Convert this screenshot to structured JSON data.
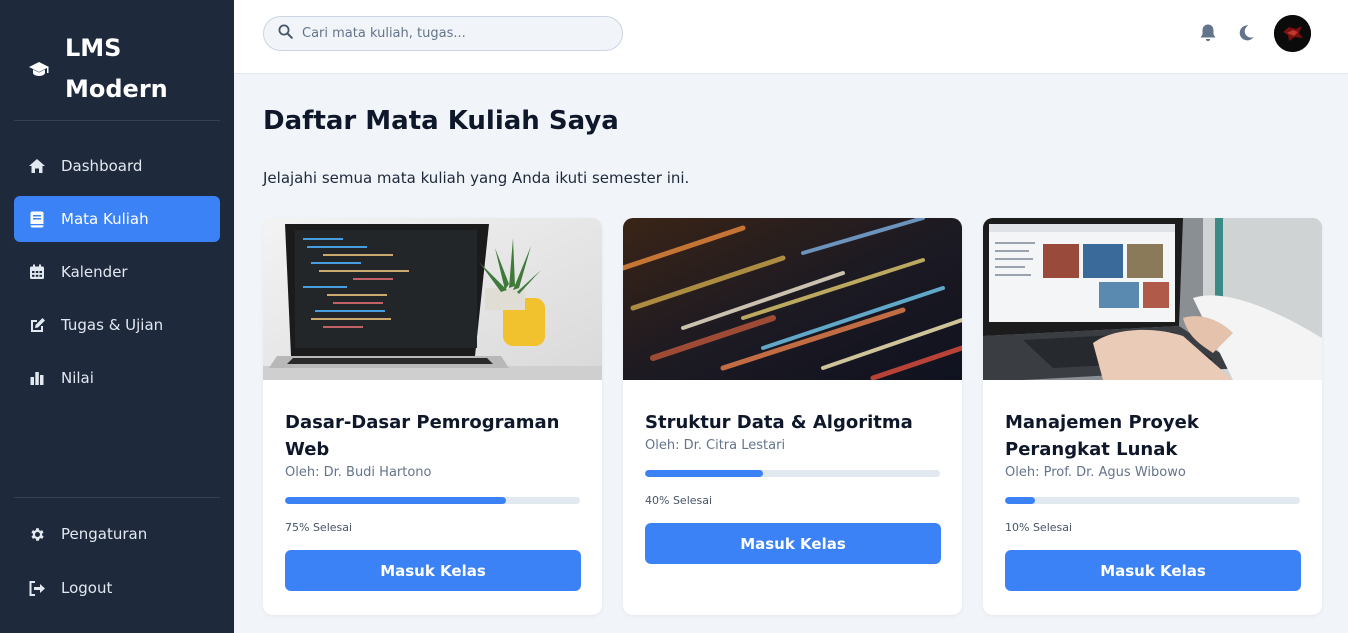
{
  "brand": {
    "title": "LMS Modern",
    "icon": "graduation-cap-icon"
  },
  "sidebar": {
    "items": [
      {
        "label": "Dashboard",
        "icon": "home-icon",
        "active": false
      },
      {
        "label": "Mata Kuliah",
        "icon": "book-icon",
        "active": true
      },
      {
        "label": "Kalender",
        "icon": "calendar-icon",
        "active": false
      },
      {
        "label": "Tugas & Ujian",
        "icon": "edit-icon",
        "active": false
      },
      {
        "label": "Nilai",
        "icon": "chart-icon",
        "active": false
      }
    ],
    "bottom": [
      {
        "label": "Pengaturan",
        "icon": "gear-icon"
      },
      {
        "label": "Logout",
        "icon": "logout-icon"
      }
    ]
  },
  "header": {
    "search_placeholder": "Cari mata kuliah, tugas...",
    "icons": [
      "bell-icon",
      "moon-icon",
      "avatar"
    ]
  },
  "main": {
    "title": "Daftar Mata Kuliah Saya",
    "subtitle": "Jelajahi semua mata kuliah yang Anda ikuti semester ini.",
    "courses": [
      {
        "title": "Dasar-Dasar Pemrograman Web",
        "lecturer": "Oleh: Dr. Budi Hartono",
        "progress": 75,
        "progress_text": "75% Selesai",
        "button": "Masuk Kelas"
      },
      {
        "title": "Struktur Data & Algoritma",
        "lecturer": "Oleh: Dr. Citra Lestari",
        "progress": 40,
        "progress_text": "40% Selesai",
        "button": "Masuk Kelas"
      },
      {
        "title": "Manajemen Proyek Perangkat Lunak",
        "lecturer": "Oleh: Prof. Dr. Agus Wibowo",
        "progress": 10,
        "progress_text": "10% Selesai",
        "button": "Masuk Kelas"
      }
    ]
  },
  "colors": {
    "sidebar_bg": "#1e293b",
    "accent": "#3b82f6",
    "page_bg": "#f1f5f9"
  }
}
